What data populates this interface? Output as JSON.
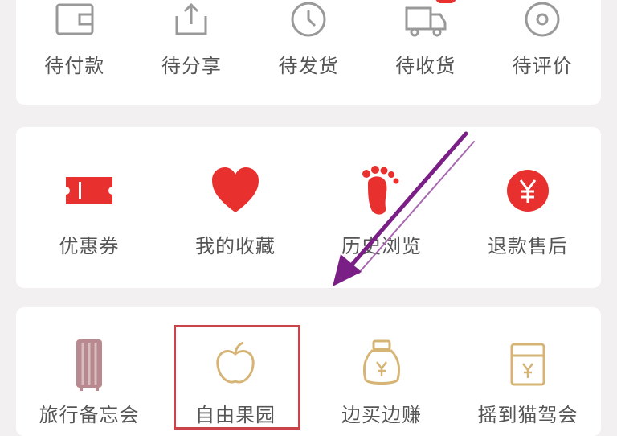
{
  "orders": {
    "items": [
      {
        "label": "待付款",
        "icon": "wallet-icon"
      },
      {
        "label": "待分享",
        "icon": "share-icon"
      },
      {
        "label": "待发货",
        "icon": "clock-icon"
      },
      {
        "label": "待收货",
        "icon": "truck-icon",
        "badge": ""
      },
      {
        "label": "待评价",
        "icon": "review-icon"
      }
    ]
  },
  "services": {
    "items": [
      {
        "label": "优惠券",
        "icon": "coupon-icon"
      },
      {
        "label": "我的收藏",
        "icon": "heart-icon"
      },
      {
        "label": "历史浏览",
        "icon": "footprint-icon"
      },
      {
        "label": "退款售后",
        "icon": "refund-icon"
      }
    ]
  },
  "tools": {
    "items": [
      {
        "label": "旅行备忘会",
        "icon": "luggage-icon"
      },
      {
        "label": "自由果园",
        "icon": "apple-icon",
        "highlighted": true
      },
      {
        "label": "边买边赚",
        "icon": "money-bag-icon"
      },
      {
        "label": "摇到猫驾会",
        "icon": "gift-box-icon"
      }
    ]
  },
  "colors": {
    "accent": "#e8312f",
    "gold": "#d6b476",
    "pinkbrown": "#b88a8f",
    "highlight": "#c9434a",
    "arrow": "#7a1f86"
  }
}
